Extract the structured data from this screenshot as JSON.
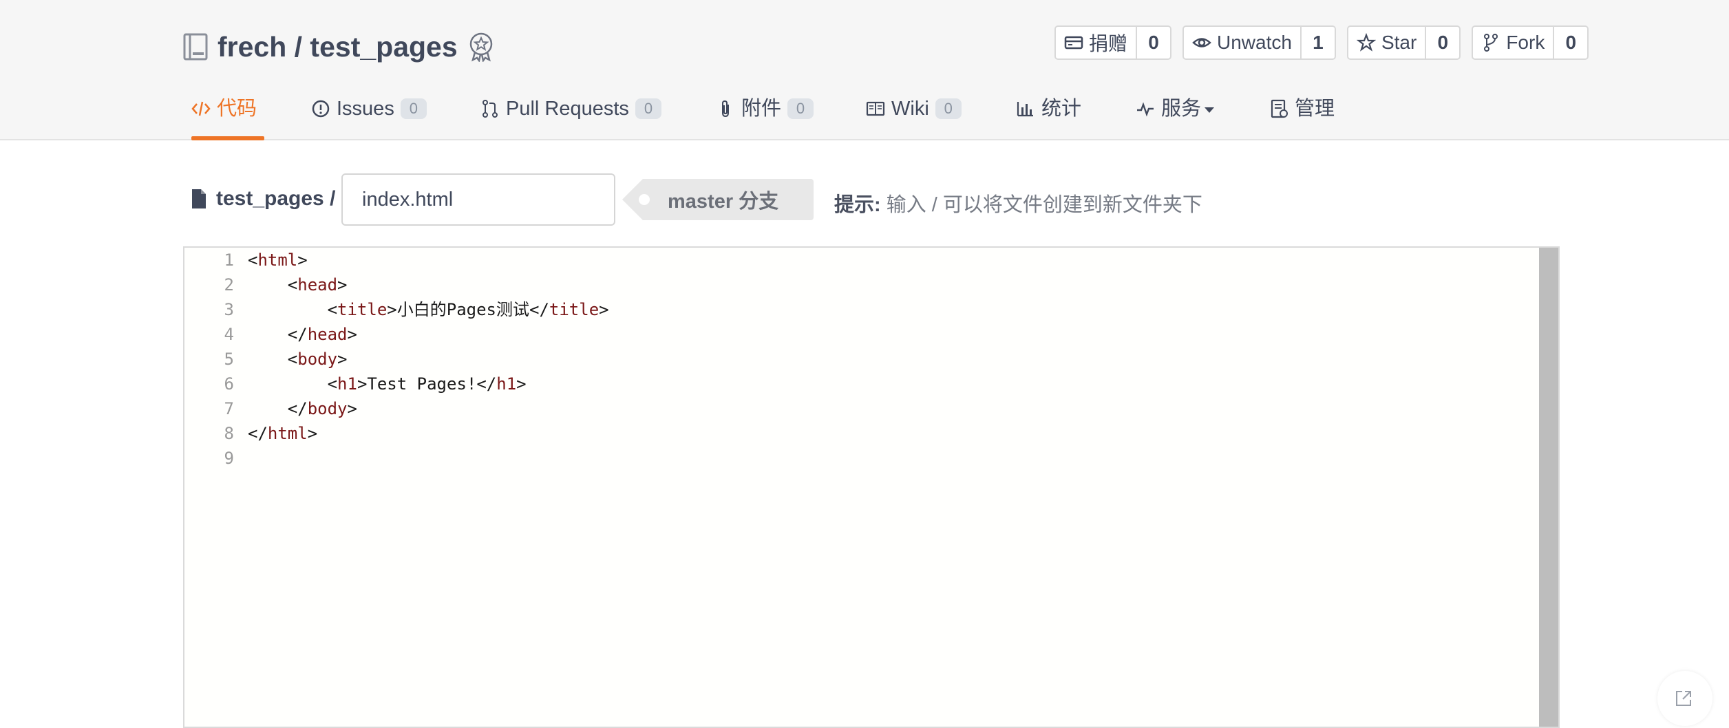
{
  "repo": {
    "owner": "frech",
    "separator": " / ",
    "name": "test_pages",
    "full": "frech / test_pages"
  },
  "actions": [
    {
      "label": "捐赠",
      "count": "0",
      "icon": "card-icon"
    },
    {
      "label": "Unwatch",
      "count": "1",
      "icon": "eye-icon"
    },
    {
      "label": "Star",
      "count": "0",
      "icon": "star-icon"
    },
    {
      "label": "Fork",
      "count": "0",
      "icon": "fork-icon"
    }
  ],
  "tabs": [
    {
      "label": "代码",
      "icon": "code-icon",
      "active": true
    },
    {
      "label": "Issues",
      "count": "0",
      "icon": "issue-icon"
    },
    {
      "label": "Pull Requests",
      "count": "0",
      "icon": "pull-request-icon"
    },
    {
      "label": "附件",
      "count": "0",
      "icon": "paperclip-icon"
    },
    {
      "label": "Wiki",
      "count": "0",
      "icon": "book-icon"
    },
    {
      "label": "统计",
      "icon": "bar-chart-icon"
    },
    {
      "label": "服务",
      "icon": "pulse-icon",
      "dropdown": true
    },
    {
      "label": "管理",
      "icon": "settings-doc-icon"
    }
  ],
  "file": {
    "breadcrumb": "test_pages /",
    "filename": "index.html",
    "branch": "master 分支",
    "hint_label": "提示:",
    "hint_text": " 输入 / 可以将文件创建到新文件夹下"
  },
  "code": {
    "line_numbers": [
      "1",
      "2",
      "3",
      "4",
      "5",
      "6",
      "7",
      "8",
      "9"
    ],
    "lines": [
      "<html>",
      "    <head>",
      "        <title>小白的Pages测试</title>",
      "    </head>",
      "    <body>",
      "        <h1>Test Pages!</h1>",
      "    </body>",
      "</html>",
      ""
    ]
  },
  "colors": {
    "accent": "#ee7426",
    "text": "#40485b",
    "tag": "#7a1717",
    "header_bg": "#f6f6f6"
  }
}
